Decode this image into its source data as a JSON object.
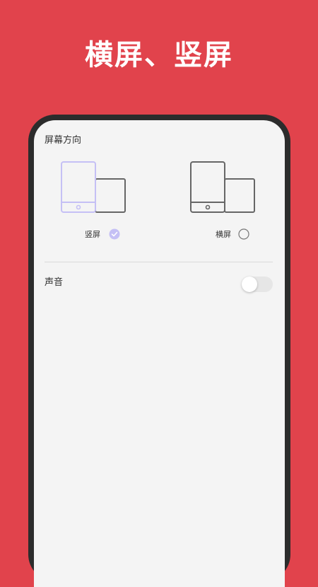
{
  "headline": "横屏、竖屏",
  "colors": {
    "background": "#e1434c",
    "phone_frame": "#2c2c2c",
    "screen": "#f4f4f4",
    "accent": "#c5c0f5",
    "device_outline": "#666666"
  },
  "settings": {
    "orientation_title": "屏幕方向",
    "options": [
      {
        "label": "竖屏",
        "selected": true,
        "icon": "portrait-device-icon"
      },
      {
        "label": "横屏",
        "selected": false,
        "icon": "landscape-device-icon"
      }
    ],
    "sound_label": "声音",
    "sound_enabled": false
  }
}
